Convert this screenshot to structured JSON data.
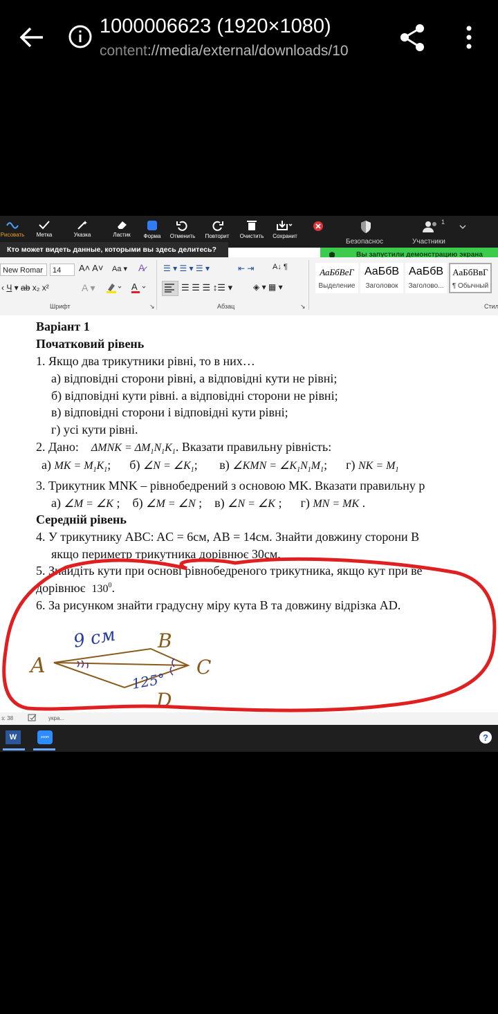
{
  "viewer": {
    "title": "1000006623 (1920×1080)",
    "uri_scheme": "content",
    "uri_rest": "://media/external/downloads/10"
  },
  "zoom": {
    "tools": [
      {
        "key": "draw",
        "label": "Рисовать"
      },
      {
        "key": "stamp",
        "label": "Метка"
      },
      {
        "key": "pointer",
        "label": "Указка"
      },
      {
        "key": "eraser",
        "label": "Ластик"
      },
      {
        "key": "shape",
        "label": "Форма"
      },
      {
        "key": "undo",
        "label": "Отменить"
      },
      {
        "key": "redo",
        "label": "Повторит"
      },
      {
        "key": "clear",
        "label": "Очистить"
      },
      {
        "key": "save",
        "label": "Сохранит"
      }
    ],
    "security_label": "Безопаснос",
    "participants_label": "Участники",
    "participants_count": "1",
    "share_tip": "Кто может видеть данные, которыми вы здесь делитесь?",
    "demo_banner": "Вы запустили демонстрацию экрана",
    "accent_color": "#3bcb4d"
  },
  "word": {
    "font_name": "New Romar",
    "font_size": "14",
    "group_font": "Шрифт",
    "group_paragraph": "Абзац",
    "group_styles": "Стил",
    "styles": [
      {
        "preview": "АаБбВеГ",
        "name": "Выделение"
      },
      {
        "preview": "АаБбВ",
        "name": "Заголовок"
      },
      {
        "preview": "АаБбВ",
        "name": "Заголово..."
      },
      {
        "preview": "АаБбВвГ",
        "name": "¶ Обычный"
      }
    ],
    "status_page": "з: 38",
    "status_lang": "укра..."
  },
  "document": {
    "variant": "Варіант 1",
    "level1": "Початковий рівень",
    "q1": "1. Якщо два трикутники рівні, то в них…",
    "q1a": "а) відповідні сторони рівні, а відповідні кути не рівні;",
    "q1b": "б) відповідні кути рівні. а відповідні сторони не рівні;",
    "q1c": "в) відповідні сторони і відповідні кути рівні;",
    "q1d": "г) усі кути рівні.",
    "q2_prefix": "2. Дано:",
    "q2_suffix": ". Вказати правильну рівність:",
    "q3": "3. Трикутник MNK – рівнобедрений з основою MK. Вказати правильну р",
    "level2": "Середній рівень",
    "q4": "4. У трикутнику ABC:  AC = 6см, AB = 14см. Знайти довжину сторони B",
    "q4b": "якщо периметр трикутника дорівнює 30см.",
    "q5": "5. Знайдіть кути при основі рівнобедреного трикутника, якщо кут при ве",
    "q5b": "дорівнює",
    "q5_angle": "130",
    "q6": "6. За рисунком знайти градусну міру кута B та довжину відрізка AD.",
    "figure": {
      "label_a": "A",
      "label_b": "B",
      "label_c": "C",
      "label_d": "D",
      "side_ab": "9 см",
      "angle_d": "125°"
    }
  },
  "annotation_color": "#e02020"
}
